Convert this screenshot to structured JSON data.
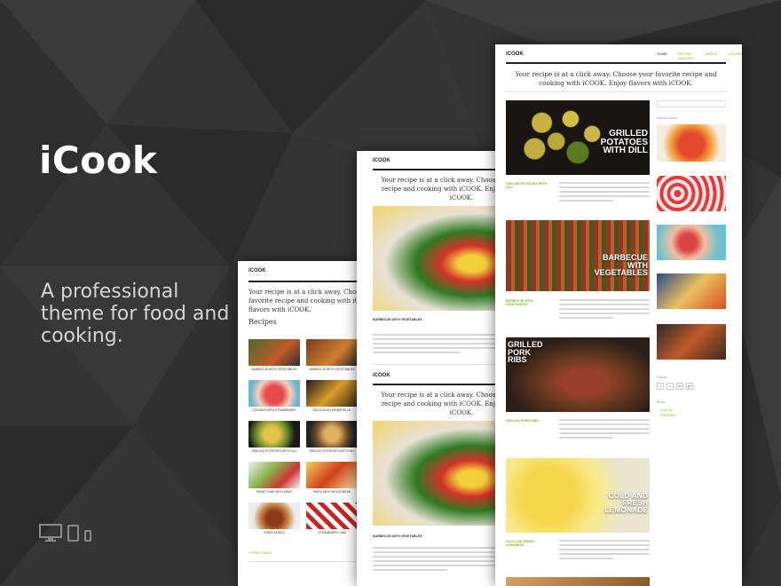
{
  "hero": {
    "title": "iCook",
    "tagline": "A professional theme for food and cooking."
  },
  "icons": [
    "monitor-icon",
    "tablet-icon",
    "phone-icon"
  ],
  "colors": {
    "accent": "#7dbb1d",
    "background": "#2f2f2f"
  },
  "screen_left": {
    "logo": "iCOOK",
    "tagline": "Your recipe is at a click away. Choose your favorite recipe and cooking with iCOOK. Enjoy flavors with iCOOK.",
    "section": "Recipes",
    "recipes": [
      "BARBECUE WITH VEGETABLES",
      "BARBECUE WITH VEGETABLES",
      "COOKIES WITH STRAWBERRY",
      "DELICIOUS HORNSPELLS",
      "GRILLED POTATOES WITH DILL",
      "GRILLED POTATOES WITH DILL",
      "PANETTONE WITH MEAT",
      "PASTA WITH BOLOGNESE",
      "STAKE NORKA",
      "STRAWBERRY JAM"
    ],
    "prev_page": "« PREV PAGE"
  },
  "screen_middle": {
    "logo": "iCOOK",
    "tagline": "Your recipe is at a click away. Choose your favorite recipe and cooking with iCOOK. Enjoy flavors with iCOOK.",
    "post_title": "BARBECUE WITH VEGETABLES",
    "post_title_2": "BARBECUE WITH VEGETABLES"
  },
  "screen_right": {
    "logo": "iCOOK",
    "nav": [
      "HOME",
      "RECIPE GALLERY",
      "ABOUT",
      "CONTACT"
    ],
    "tagline": "Your recipe is at a click away. Choose your favorite recipe and cooking with iCOOK. Enjoy flavors with iCOOK.",
    "posts": [
      {
        "title": "GRILLED POTATOES WITH DILL",
        "overlay": "GRILLED POTATOES WITH DILL"
      },
      {
        "title": "BARBECUE WITH VEGETABLES",
        "overlay": "BARBECUE WITH VEGETABLES"
      },
      {
        "title": "GRILLED PORK RIBS",
        "overlay": "GRILLED PORK RIBS"
      },
      {
        "title": "COLD AND FRESH LEMONADE",
        "overlay": "COLD AND FRESH LEMONADE"
      }
    ],
    "side_label_recent": "Recent posts",
    "side_label_social": "Follow",
    "side_label_meta": "Meta",
    "side_links": [
      "LOG IN",
      "ENTRIES"
    ],
    "social": [
      "f",
      "t",
      "in",
      "g+"
    ]
  }
}
